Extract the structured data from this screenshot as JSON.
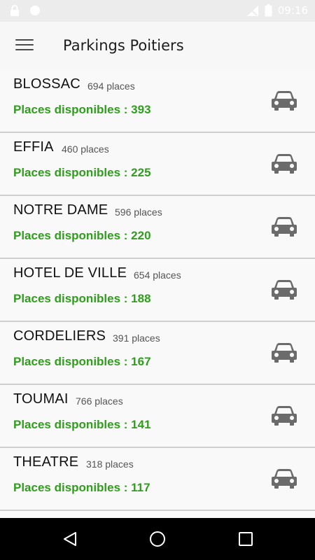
{
  "status_bar": {
    "time": "09:16",
    "icons": [
      "lock-icon",
      "notification-icon",
      "signal-icon",
      "battery-icon"
    ]
  },
  "app_bar": {
    "menu_icon": "hamburger-menu-icon",
    "title": "Parkings Poitiers"
  },
  "parkings": [
    {
      "name": "BLOSSAC",
      "places": "694 places",
      "available": "Places disponibles : 393"
    },
    {
      "name": "EFFIA",
      "places": "460 places",
      "available": "Places disponibles : 225"
    },
    {
      "name": "NOTRE DAME",
      "places": "596 places",
      "available": "Places disponibles : 220"
    },
    {
      "name": "HOTEL DE VILLE",
      "places": "654 places",
      "available": "Places disponibles : 188"
    },
    {
      "name": "CORDELIERS",
      "places": "391 places",
      "available": "Places disponibles : 167"
    },
    {
      "name": "TOUMAI",
      "places": "766 places",
      "available": "Places disponibles : 141"
    },
    {
      "name": "THEATRE",
      "places": "318 places",
      "available": "Places disponibles : 117"
    }
  ],
  "colors": {
    "available_text": "#2e9f1a",
    "car_icon": "#6b6b6b",
    "nav_bar": "#000000"
  },
  "nav_bar": {
    "buttons": [
      "back-icon",
      "home-icon",
      "recents-icon"
    ]
  }
}
